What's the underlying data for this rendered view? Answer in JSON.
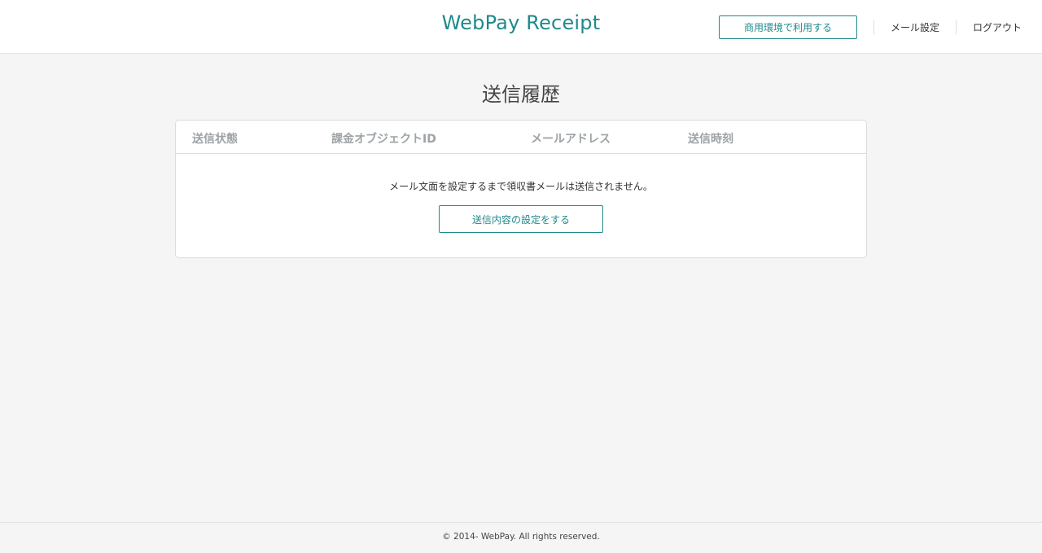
{
  "header": {
    "brand": "WebPay Receipt",
    "production_button": "商用環境で利用する",
    "mail_settings_link": "メール設定",
    "logout_link": "ログアウト"
  },
  "main": {
    "title": "送信履歴",
    "table": {
      "columns": [
        "送信状態",
        "課金オブジェクトID",
        "メールアドレス",
        "送信時刻"
      ],
      "rows": []
    },
    "empty_message": "メール文面を設定するまで領収書メールは送信されません。",
    "setup_button": "送信内容の設定をする"
  },
  "footer": {
    "copyright": "© 2014- WebPay. All rights reserved."
  },
  "colors": {
    "accent": "#1f8a8c",
    "background": "#f5f5f5",
    "header_text_muted": "#9da3a6"
  }
}
